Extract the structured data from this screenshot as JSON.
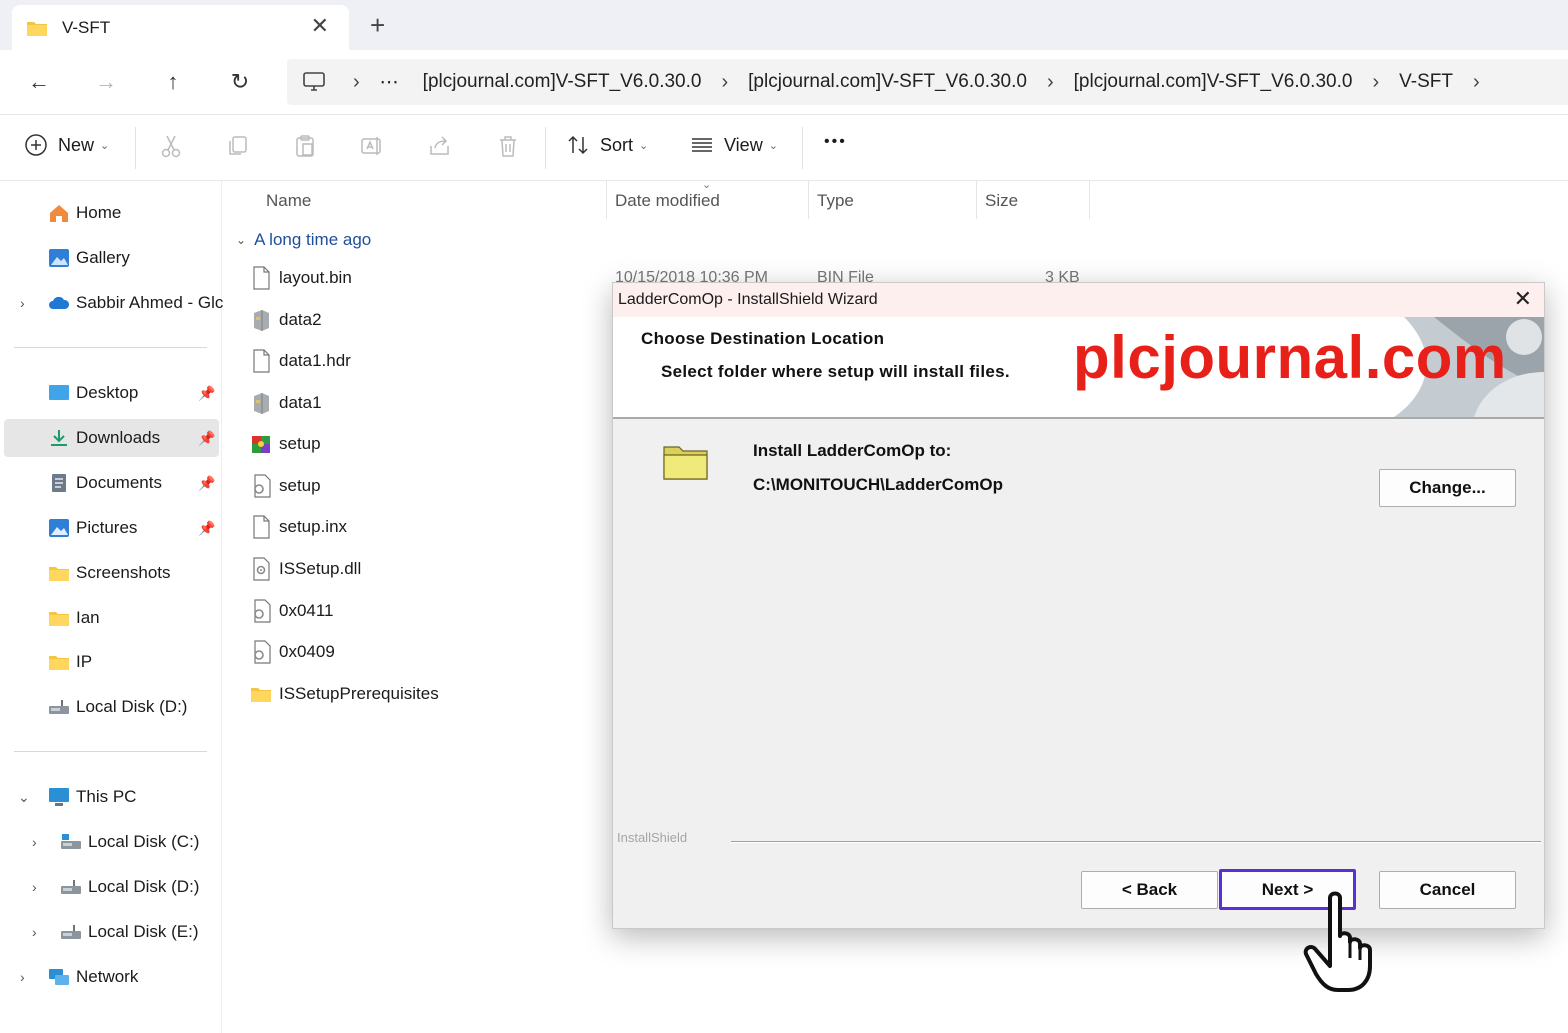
{
  "tab": {
    "title": "V-SFT",
    "close": "✕",
    "new_tab": "+"
  },
  "nav": {
    "back": "←",
    "forward": "→",
    "up": "↑",
    "refresh": "↻",
    "breadcrumb": [
      "⋯",
      "[plcjournal.com]V-SFT_V6.0.30.0",
      "[plcjournal.com]V-SFT_V6.0.30.0",
      "[plcjournal.com]V-SFT_V6.0.30.0",
      "V-SFT"
    ],
    "separator": "›"
  },
  "toolbar": {
    "new_label": "New",
    "sort_label": "Sort",
    "view_label": "View",
    "more": "•••",
    "chevron": "⌄"
  },
  "sidebar": {
    "items": [
      {
        "label": "Home",
        "icon": "home-icon"
      },
      {
        "label": "Gallery",
        "icon": "gallery-icon"
      },
      {
        "label": "Sabbir Ahmed - Glc",
        "icon": "cloud-icon"
      },
      {
        "label": "Desktop",
        "icon": "desktop-icon"
      },
      {
        "label": "Downloads",
        "icon": "download-icon"
      },
      {
        "label": "Documents",
        "icon": "documents-icon"
      },
      {
        "label": "Pictures",
        "icon": "pictures-icon"
      },
      {
        "label": "Screenshots",
        "icon": "folder-icon"
      },
      {
        "label": "Ian",
        "icon": "folder-icon"
      },
      {
        "label": "IP",
        "icon": "folder-icon"
      },
      {
        "label": "Local Disk (D:)",
        "icon": "drive-icon"
      },
      {
        "label": "This PC",
        "icon": "pc-icon"
      },
      {
        "label": "Local Disk (C:)",
        "icon": "drive-icon"
      },
      {
        "label": "Local Disk (D:)",
        "icon": "drive-icon"
      },
      {
        "label": "Local Disk (E:)",
        "icon": "drive-icon"
      },
      {
        "label": "Network",
        "icon": "network-icon"
      }
    ],
    "pin": "📌",
    "expand": "›",
    "expanded": "⌄"
  },
  "filelist": {
    "columns": [
      "Name",
      "Date modified",
      "Type",
      "Size"
    ],
    "group": "A long time ago",
    "files": [
      {
        "name": "layout.bin",
        "icon": "file-icon"
      },
      {
        "name": "data2",
        "icon": "cabinet-icon"
      },
      {
        "name": "data1.hdr",
        "icon": "file-icon"
      },
      {
        "name": "data1",
        "icon": "cabinet-icon"
      },
      {
        "name": "setup",
        "icon": "setup-icon"
      },
      {
        "name": "setup",
        "icon": "config-file-icon"
      },
      {
        "name": "setup.inx",
        "icon": "file-icon"
      },
      {
        "name": "ISSetup.dll",
        "icon": "dll-icon"
      },
      {
        "name": "0x0411",
        "icon": "config-file-icon"
      },
      {
        "name": "0x0409",
        "icon": "config-file-icon"
      },
      {
        "name": "ISSetupPrerequisites",
        "icon": "folder-icon"
      }
    ],
    "first_row": {
      "date": "10/15/2018 10:36 PM",
      "type": "BIN File",
      "size": "3 KB"
    }
  },
  "dialog": {
    "title": "LadderComOp - InstallShield Wizard",
    "close": "✕",
    "heading": "Choose Destination Location",
    "subheading": "Select folder where setup will install files.",
    "watermark": "plcjournal.com",
    "install_label": "Install LadderComOp to:",
    "install_path": "C:\\MONITOUCH\\LadderComOp",
    "change_button": "Change...",
    "brand": "InstallShield",
    "back_button": "< Back",
    "next_button": "Next >",
    "cancel_button": "Cancel"
  },
  "colors": {
    "accent": "#1e4f9a",
    "watermark": "#e8201a",
    "focus": "#5b2fd6"
  }
}
